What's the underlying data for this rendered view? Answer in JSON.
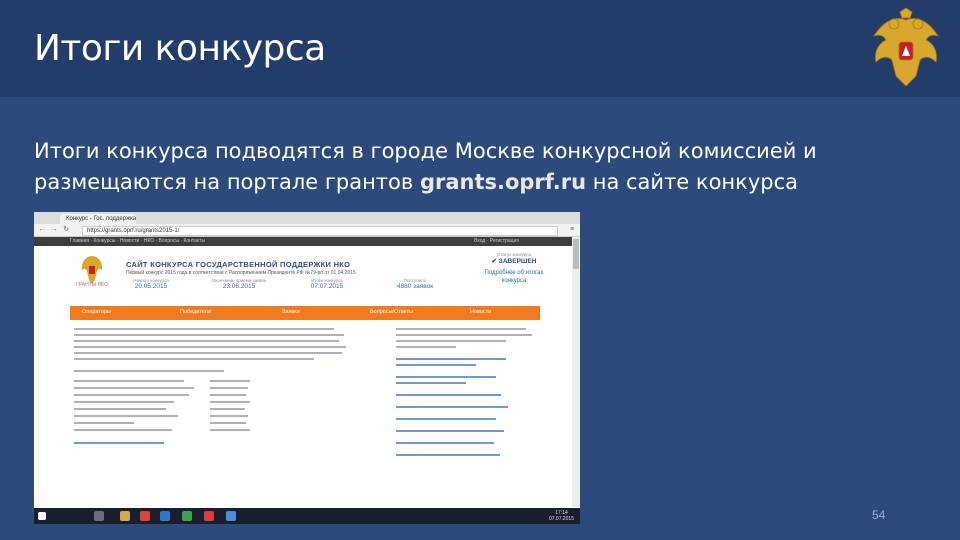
{
  "slide": {
    "title": "Итоги конкурса",
    "description_before": "Итоги конкурса подводятся в городе Москве конкурсной комиссией и размещаются на портале грантов ",
    "link_text": "grants.oprf.ru",
    "description_after": " на сайте конкурса",
    "page_number": "54"
  },
  "browser": {
    "tab_title": "Конкурс - Гос. поддержка...",
    "address": "https://grants.oprf.ru/grants2015-1/",
    "site_bar_left": "Главная · Конкурсы · Новости · НКО · Вопросы · Контакты",
    "site_bar_right": "Вход · Регистрация"
  },
  "site": {
    "title": "САЙТ КОНКУРСА ГОСУДАРСТВЕННОЙ ПОДДЕРЖКИ НКО",
    "subtitle": "Первый конкурс 2015 года в соответствии с Распоряжением Президента РФ №79-рп от 01.04.2015",
    "logo_caption": "ГРАНТЫ НКО",
    "stats": [
      {
        "label": "Начало конкурса",
        "value": "20.05.2015"
      },
      {
        "label": "Окончание приема заявок",
        "value": "23.06.2015"
      },
      {
        "label": "Итоги конкурса",
        "value": "07.07.2015"
      },
      {
        "label": "Поступило",
        "value": "4880 заявок"
      }
    ],
    "status_label": "Статус конкурса",
    "status_value": "✔ ЗАВЕРШЕН",
    "details_link": "Подробнее об итогах конкурса",
    "menu": [
      "Операторы",
      "Победители",
      "Заявки",
      "Вопросы/Ответы",
      "Новости"
    ]
  },
  "taskbar": {
    "time": "17:14",
    "date": "07.07.2015"
  },
  "colors": {
    "slide_bg": "#2c4a7c",
    "header_bg": "#233d6a",
    "site_menu": "#f07a1e",
    "site_title": "#2a4d8f"
  }
}
